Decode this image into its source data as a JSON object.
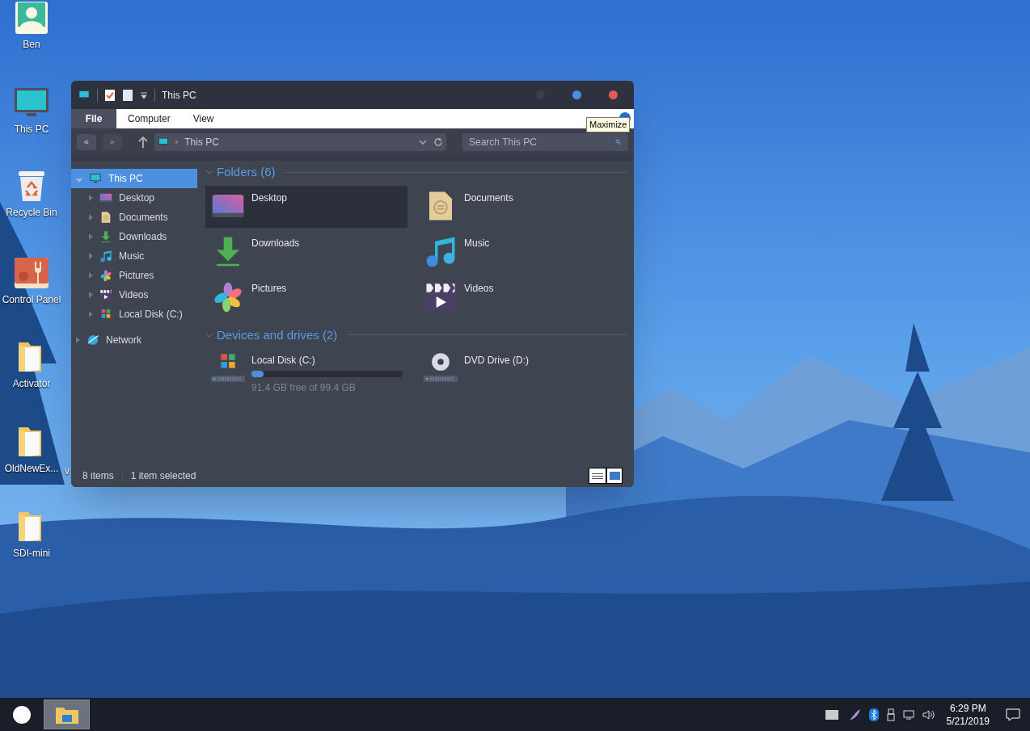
{
  "desktop": {
    "icons": [
      {
        "label": "Ben",
        "kind": "user"
      },
      {
        "label": "This PC",
        "kind": "pc"
      },
      {
        "label": "Recycle Bin",
        "kind": "recycle"
      },
      {
        "label": "Control Panel",
        "kind": "control"
      },
      {
        "label": "Activator",
        "kind": "folder"
      },
      {
        "label": "OldNewEx...",
        "kind": "folder"
      },
      {
        "label": "SDI-mini",
        "kind": "folder"
      }
    ],
    "partial_label": "v"
  },
  "window": {
    "title": "This PC",
    "ribbon_tabs": [
      {
        "label": "File",
        "selected": true
      },
      {
        "label": "Computer",
        "selected": false
      },
      {
        "label": "View",
        "selected": false
      }
    ],
    "tooltip": "Maximize",
    "nav": {
      "back": "«",
      "forward": "»"
    },
    "address": "This PC",
    "address_separator": "›",
    "search": {
      "placeholder": "Search This PC"
    },
    "sidebar": [
      {
        "label": "This PC",
        "kind": "pc",
        "selected": true,
        "expanded": true,
        "children": [
          {
            "label": "Desktop",
            "kind": "desktop",
            "selected": false
          },
          {
            "label": "Documents",
            "kind": "documents",
            "selected": false
          },
          {
            "label": "Downloads",
            "kind": "downloads",
            "selected": false
          },
          {
            "label": "Music",
            "kind": "music",
            "selected": false
          },
          {
            "label": "Pictures",
            "kind": "pictures",
            "selected": false
          },
          {
            "label": "Videos",
            "kind": "videos",
            "selected": false
          },
          {
            "label": "Local Disk (C:)",
            "kind": "disk",
            "selected": false
          }
        ]
      },
      {
        "label": "Network",
        "kind": "network",
        "selected": false,
        "expanded": false
      }
    ],
    "groups": [
      {
        "title": "Folders (6)",
        "items": [
          {
            "label": "Desktop",
            "kind": "desktop",
            "selected": true
          },
          {
            "label": "Documents",
            "kind": "documents",
            "selected": false
          },
          {
            "label": "Downloads",
            "kind": "downloads",
            "selected": false
          },
          {
            "label": "Music",
            "kind": "music",
            "selected": false
          },
          {
            "label": "Pictures",
            "kind": "pictures",
            "selected": false
          },
          {
            "label": "Videos",
            "kind": "videos",
            "selected": false
          }
        ]
      },
      {
        "title": "Devices and drives (2)",
        "items": [
          {
            "label": "Local Disk (C:)",
            "kind": "disk",
            "selected": false,
            "level": 0.08,
            "free": "91.4 GB free of 99.4 GB"
          },
          {
            "label": "DVD Drive (D:)",
            "kind": "dvd",
            "selected": false
          }
        ]
      }
    ],
    "status_bar": {
      "items": "8 items",
      "selection": "1 item selected"
    }
  },
  "taskbar": {
    "time": "6:29 PM",
    "date": "5/21/2019"
  }
}
